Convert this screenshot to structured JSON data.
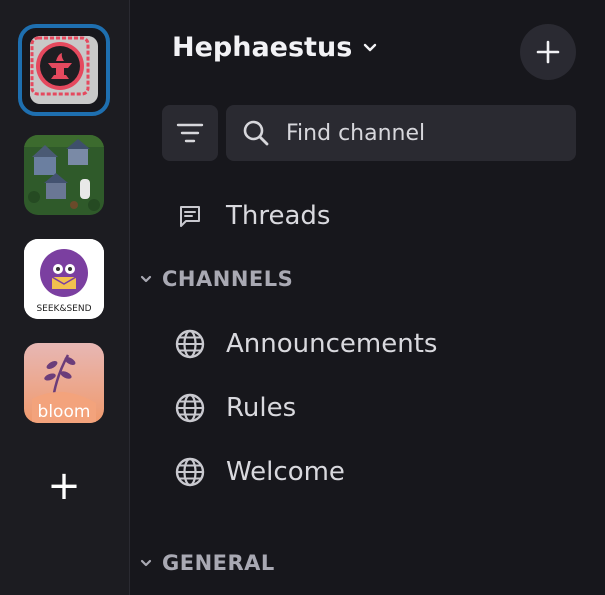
{
  "servers": [
    {
      "name": "Hephaestus",
      "active": true
    },
    {
      "name": "village-game"
    },
    {
      "name": "seek-and-send",
      "label": "SEEK&SEND"
    },
    {
      "name": "bloom",
      "label": "bloom"
    }
  ],
  "rail": {
    "add_label": "+"
  },
  "header": {
    "server_name": "Hephaestus"
  },
  "search": {
    "placeholder": "Find channel"
  },
  "threads_label": "Threads",
  "sections": [
    {
      "title": "CHANNELS",
      "channels": [
        "Announcements",
        "Rules",
        "Welcome"
      ]
    },
    {
      "title": "GENERAL"
    }
  ],
  "colors": {
    "accent_ring": "#1e6fb0",
    "background": "#17171c",
    "rail": "#1c1c21"
  }
}
